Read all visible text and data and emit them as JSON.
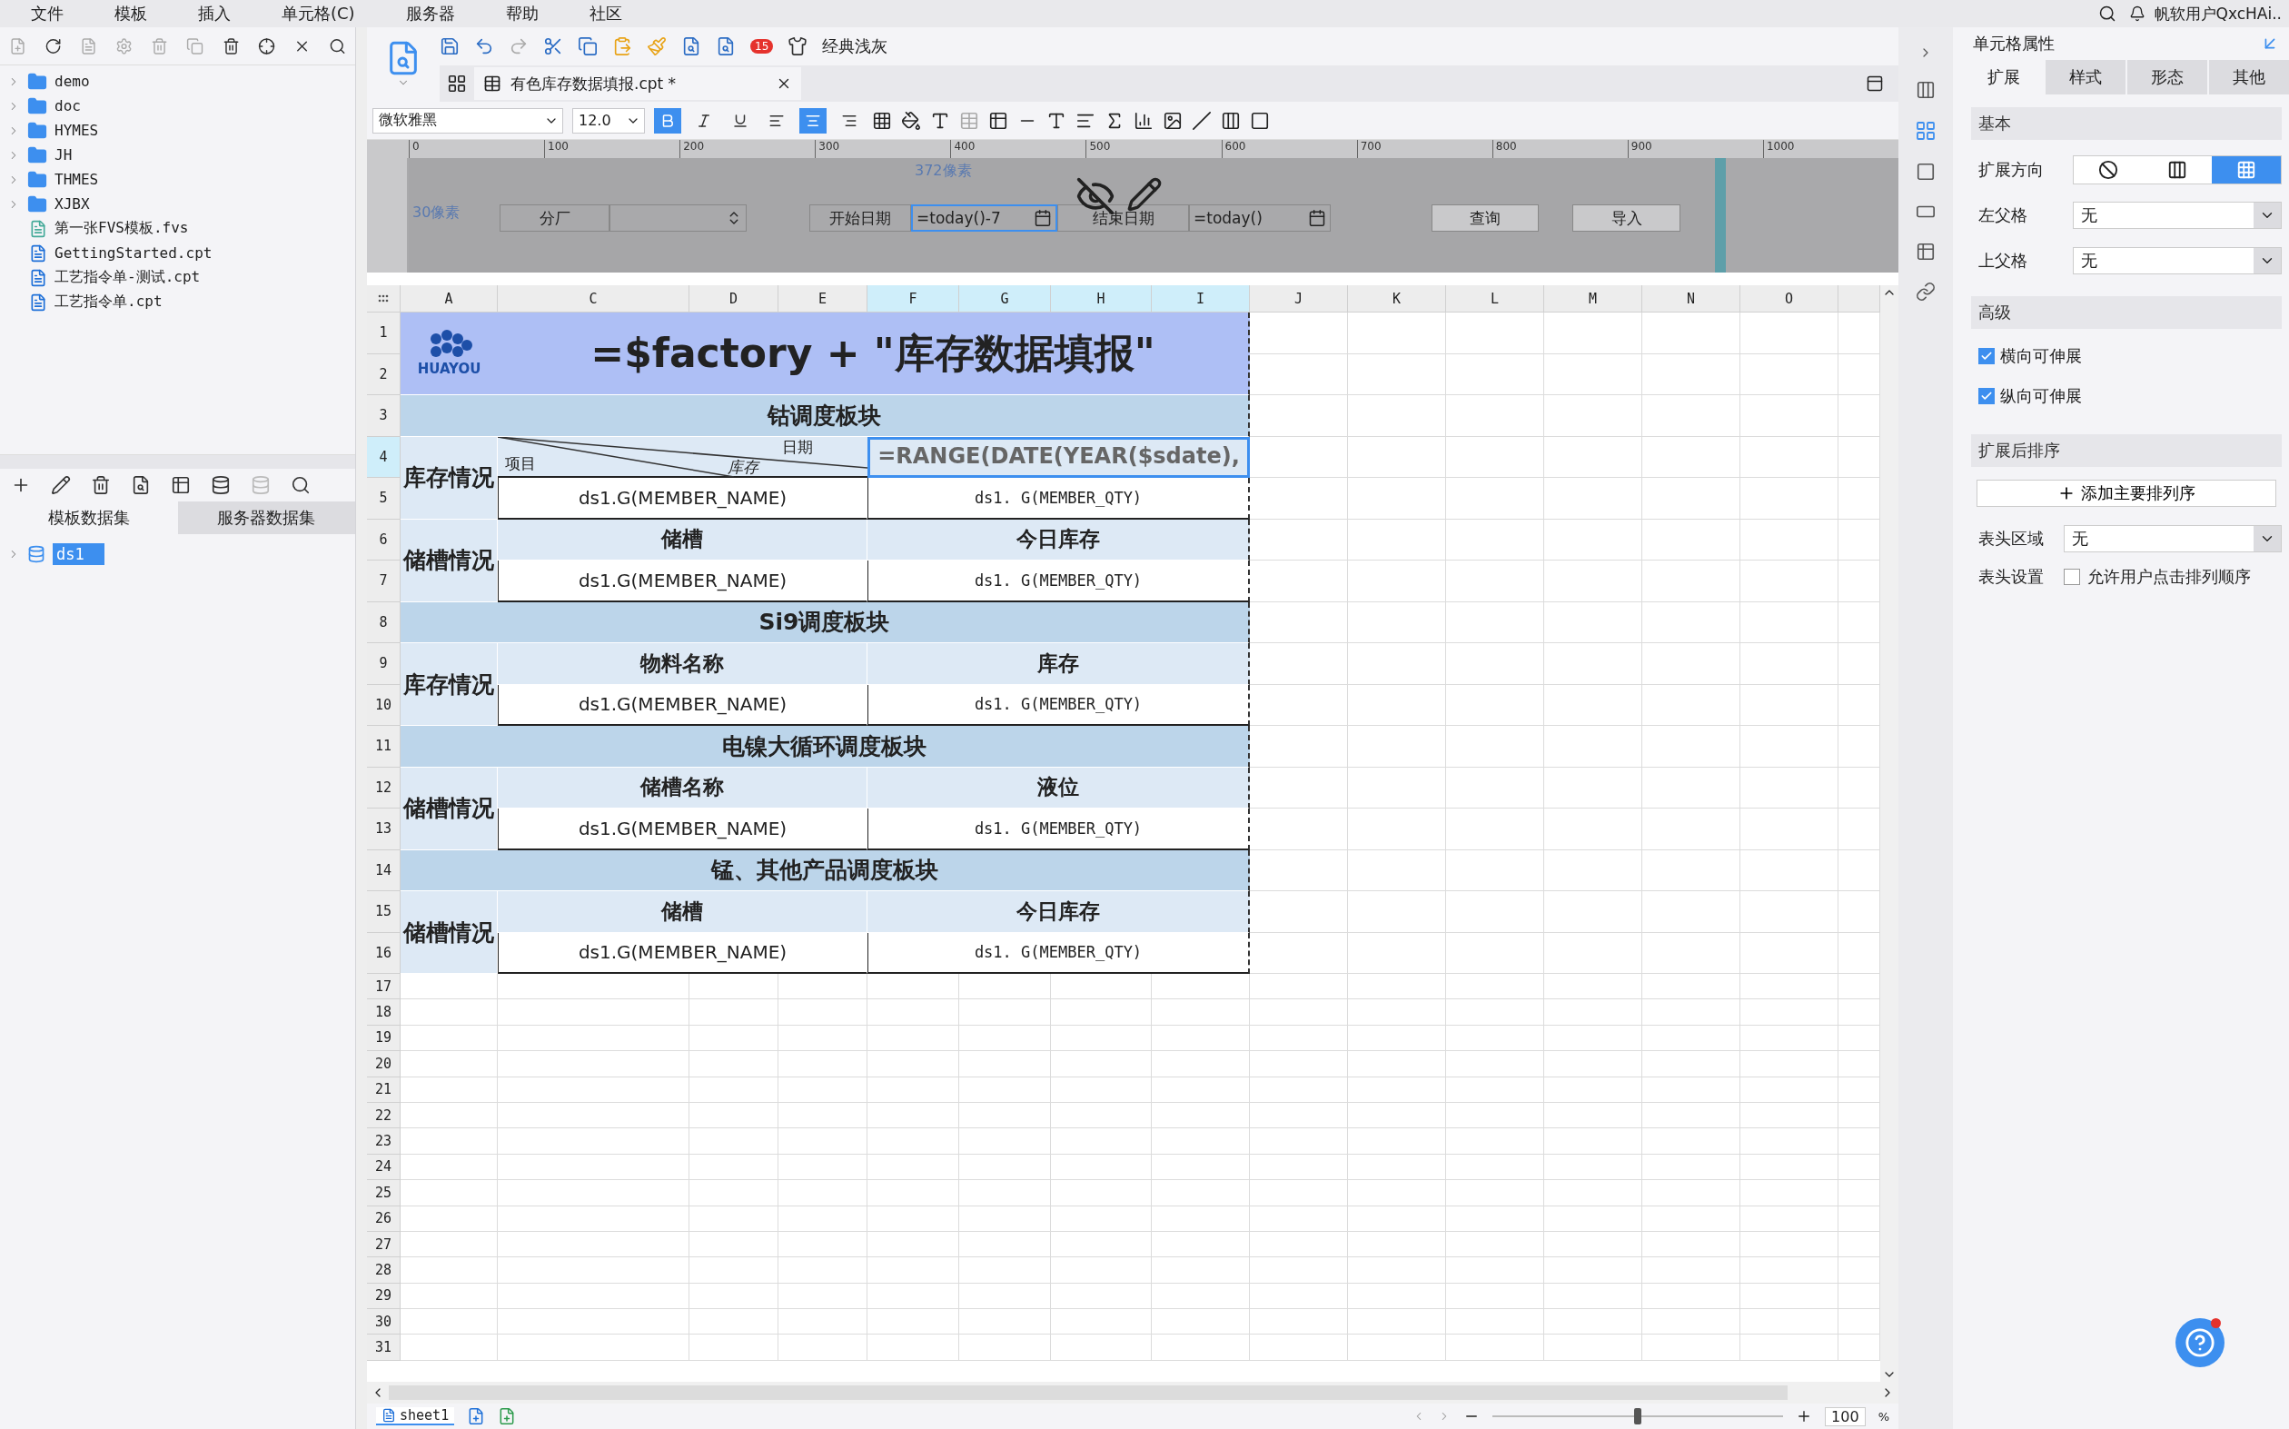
{
  "menu": [
    "文件",
    "模板",
    "插入",
    "单元格(C)",
    "服务器",
    "帮助",
    "社区"
  ],
  "user": "帆软用户QxcHAi..",
  "file_tree": [
    {
      "kind": "folder",
      "label": "demo"
    },
    {
      "kind": "folder",
      "label": "doc"
    },
    {
      "kind": "folder",
      "label": "HYMES"
    },
    {
      "kind": "folder",
      "label": "JH"
    },
    {
      "kind": "folder",
      "label": "THMES"
    },
    {
      "kind": "folder",
      "label": "XJBX"
    },
    {
      "kind": "fvs",
      "label": "第一张FVS模板.fvs"
    },
    {
      "kind": "cpt",
      "label": "GettingStarted.cpt"
    },
    {
      "kind": "cpt",
      "label": "工艺指令单-测试.cpt"
    },
    {
      "kind": "cpt",
      "label": "工艺指令单.cpt"
    }
  ],
  "dataset_tabs": [
    {
      "label": "模板数据集",
      "selected": true
    },
    {
      "label": "服务器数据集",
      "selected": false
    }
  ],
  "datasets": [
    {
      "label": "ds1",
      "selected": true
    }
  ],
  "badge": "15",
  "theme_label": "经典浅灰",
  "document_tab": {
    "label": "有色库存数据填报.cpt *",
    "selected": true
  },
  "font": "微软雅黑",
  "font_size": "12.0",
  "format_buttons": [
    {
      "kind": "bold",
      "selected": true
    },
    {
      "kind": "italic",
      "selected": false
    },
    {
      "kind": "underline",
      "selected": false
    },
    {
      "kind": "align-left",
      "selected": false
    },
    {
      "kind": "align-center",
      "selected": true
    },
    {
      "kind": "align-right",
      "selected": false
    }
  ],
  "parameter_pane": {
    "ruler": [
      "0",
      "100",
      "200",
      "300",
      "400",
      "500",
      "600",
      "700",
      "800",
      "900",
      "1000"
    ],
    "width_note": "372像素",
    "height_note": "30像素",
    "widgets": [
      {
        "kind": "label",
        "text": "分厂"
      },
      {
        "kind": "combo",
        "selected": false
      },
      {
        "kind": "label",
        "text": "开始日期"
      },
      {
        "kind": "date",
        "text": "=today()-7",
        "selected": true
      },
      {
        "kind": "label",
        "text": "结束日期"
      },
      {
        "kind": "date",
        "text": "=today()",
        "selected": false
      },
      {
        "kind": "button",
        "text": "查询"
      },
      {
        "kind": "button",
        "text": "导入"
      }
    ]
  },
  "columns": [
    {
      "label": "A",
      "selected": false
    },
    {
      "label": "C",
      "selected": false
    },
    {
      "label": "D",
      "selected": false
    },
    {
      "label": "E",
      "selected": false
    },
    {
      "label": "F",
      "selected": true
    },
    {
      "label": "G",
      "selected": true
    },
    {
      "label": "H",
      "selected": true
    },
    {
      "label": "I",
      "selected": true
    },
    {
      "label": "J",
      "selected": false
    },
    {
      "label": "K",
      "selected": false
    },
    {
      "label": "L",
      "selected": false
    },
    {
      "label": "M",
      "selected": false
    },
    {
      "label": "N",
      "selected": false
    },
    {
      "label": "O",
      "selected": false
    }
  ],
  "rows": [
    {
      "label": "1",
      "selected": false
    },
    {
      "label": "2",
      "selected": false
    },
    {
      "label": "3",
      "selected": false
    },
    {
      "label": "4",
      "selected": true
    },
    {
      "label": "5",
      "selected": false
    },
    {
      "label": "6",
      "selected": false
    },
    {
      "label": "7",
      "selected": false
    },
    {
      "label": "8",
      "selected": false
    },
    {
      "label": "9",
      "selected": false
    },
    {
      "label": "10",
      "selected": false
    },
    {
      "label": "11",
      "selected": false
    },
    {
      "label": "12",
      "selected": false
    },
    {
      "label": "13",
      "selected": false
    },
    {
      "label": "14",
      "selected": false
    },
    {
      "label": "15",
      "selected": false
    },
    {
      "label": "16",
      "selected": false
    },
    {
      "label": "17",
      "selected": false
    },
    {
      "label": "18",
      "selected": false
    },
    {
      "label": "19",
      "selected": false
    },
    {
      "label": "20",
      "selected": false
    },
    {
      "label": "21",
      "selected": false
    },
    {
      "label": "22",
      "selected": false
    },
    {
      "label": "23",
      "selected": false
    },
    {
      "label": "24",
      "selected": false
    },
    {
      "label": "25",
      "selected": false
    },
    {
      "label": "26",
      "selected": false
    },
    {
      "label": "27",
      "selected": false
    },
    {
      "label": "28",
      "selected": false
    },
    {
      "label": "29",
      "selected": false
    },
    {
      "label": "30",
      "selected": false
    },
    {
      "label": "31",
      "selected": false
    }
  ],
  "report": {
    "logo_text": "HUAYOU",
    "title": "=$factory + \"库存数据填报\"",
    "sections": [
      {
        "heading": "钴调度板块",
        "blocks": [
          {
            "kind": "diagonal",
            "label": "库存情况",
            "diagonal": [
              "日期",
              "库存",
              "项目"
            ],
            "formula": {
              "text": "=RANGE(DATE(YEAR($sdate),",
              "selected": true
            },
            "fields": [
              "ds1.G(MEMBER_NAME)",
              "ds1. G(MEMBER_QTY)"
            ]
          },
          {
            "kind": "headers",
            "label": "储槽情况",
            "headers": [
              "储槽",
              "今日库存"
            ],
            "fields": [
              "ds1.G(MEMBER_NAME)",
              "ds1. G(MEMBER_QTY)"
            ]
          }
        ]
      },
      {
        "heading": "Si9调度板块",
        "blocks": [
          {
            "kind": "headers",
            "label": "库存情况",
            "headers": [
              "物料名称",
              "库存"
            ],
            "fields": [
              "ds1.G(MEMBER_NAME)",
              "ds1. G(MEMBER_QTY)"
            ]
          }
        ]
      },
      {
        "heading": "电镍大循环调度板块",
        "blocks": [
          {
            "kind": "headers",
            "label": "储槽情况",
            "headers": [
              "储槽名称",
              "液位"
            ],
            "fields": [
              "ds1.G(MEMBER_NAME)",
              "ds1. G(MEMBER_QTY)"
            ]
          }
        ]
      },
      {
        "heading": "锰、其他产品调度板块",
        "blocks": [
          {
            "kind": "headers",
            "label": "储槽情况",
            "headers": [
              "储槽",
              "今日库存"
            ],
            "fields": [
              "ds1.G(MEMBER_NAME)",
              "ds1. G(MEMBER_QTY)"
            ]
          }
        ]
      }
    ]
  },
  "cell_properties": {
    "title": "单元格属性",
    "tabs": [
      {
        "label": "扩展",
        "selected": true
      },
      {
        "label": "样式",
        "selected": false
      },
      {
        "label": "形态",
        "selected": false
      },
      {
        "label": "其他",
        "selected": false
      }
    ],
    "basic": {
      "title": "基本",
      "direction_label": "扩展方向",
      "directions": [
        {
          "kind": "none",
          "selected": false
        },
        {
          "kind": "vertical",
          "selected": false
        },
        {
          "kind": "horizontal",
          "selected": true
        }
      ],
      "parents": [
        {
          "label": "左父格",
          "value": "无"
        },
        {
          "label": "上父格",
          "value": "无"
        }
      ]
    },
    "advanced": {
      "title": "高级",
      "options": [
        {
          "label": "横向可伸展",
          "checked": true
        },
        {
          "label": "纵向可伸展",
          "checked": true
        }
      ]
    },
    "sorting": {
      "title": "扩展后排序",
      "add_button": "添加主要排列序",
      "header_area": {
        "label": "表头区域",
        "value": "无"
      },
      "header_setting": {
        "label": "表头设置",
        "option": "允许用户点击排列顺序",
        "checked": false
      }
    }
  },
  "sheet_tabs": [
    {
      "label": "sheet1",
      "selected": true
    }
  ],
  "zoom": {
    "level": 0.5,
    "value": "100",
    "unit": "%"
  }
}
